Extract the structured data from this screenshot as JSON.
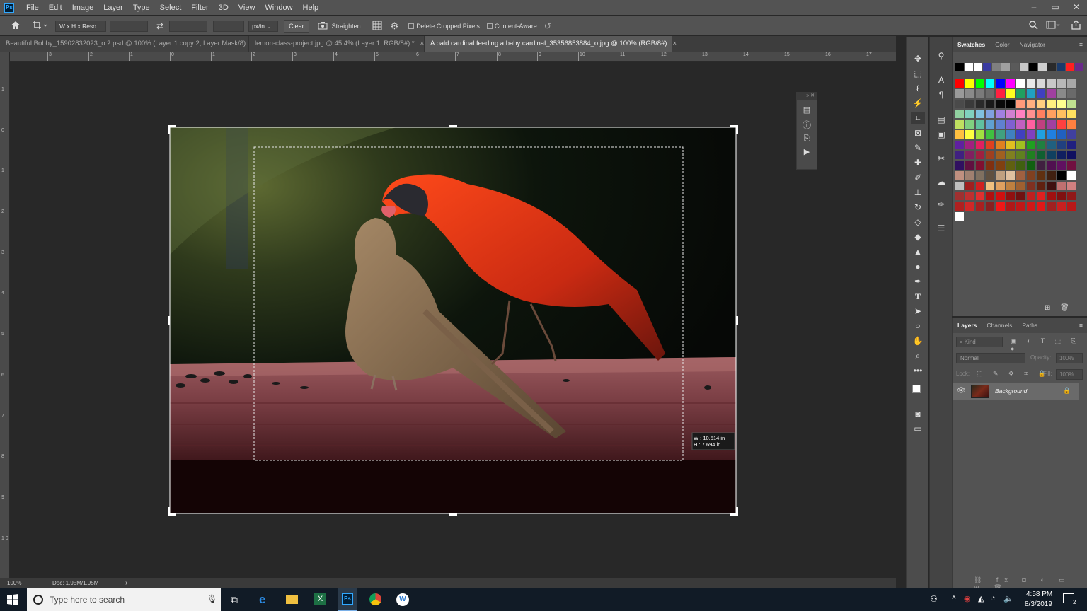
{
  "app": {
    "logo": "Ps"
  },
  "menu": [
    "File",
    "Edit",
    "Image",
    "Layer",
    "Type",
    "Select",
    "Filter",
    "3D",
    "View",
    "Window",
    "Help"
  ],
  "window_controls": [
    "–",
    "▭",
    "✕"
  ],
  "options": {
    "ratio_select": "W x H x Reso...",
    "units_select": "px/in",
    "clear": "Clear",
    "straighten": "Straighten",
    "delete_cropped": "Delete Cropped Pixels",
    "content_aware": "Content-Aware"
  },
  "tabs": [
    {
      "label": "Beautiful Bobby_15902832023_o 2.psd @ 100% (Layer 1 copy 2, Layer Mask/8)",
      "close": "×"
    },
    {
      "label": "lemon-class-project.jpg @ 45.4% (Layer 1, RGB/8#) *",
      "close": "×"
    },
    {
      "label": "A bald cardinal feeding a baby cardinal_35356853884_o.jpg @ 100% (RGB/8#)",
      "close": "×"
    }
  ],
  "ruler": {
    "h": [
      "3",
      "2",
      "1",
      "0",
      "1",
      "2",
      "3",
      "4",
      "5",
      "6",
      "7",
      "8",
      "9",
      "10",
      "11",
      "12",
      "13",
      "14",
      "15",
      "16",
      "17"
    ],
    "v": [
      "1",
      "0",
      "1",
      "2",
      "3",
      "4",
      "5",
      "6",
      "7",
      "8",
      "9",
      "1 0"
    ]
  },
  "crop_readout": {
    "w_label": "W :",
    "w": "10.514 in",
    "h_label": "H :",
    "h": "7.694 in"
  },
  "status": {
    "zoom": "100%",
    "doc": "Doc: 1.95M/1.95M",
    "arrow": "›"
  },
  "swatches": {
    "tabs": [
      "Swatches",
      "Color",
      "Navigator"
    ],
    "colors": [
      "#000000",
      "#ffffff",
      "#ffffff",
      "#3a3aa0",
      "#7f7f7f",
      "#a0a0a0",
      "#5a5a5a",
      "#c8c8c8",
      "#000000",
      "#d0d0d0",
      "#2a2a2a",
      "#1a3a6a",
      "#ff2020",
      "#6a2a8a",
      "#ff0000",
      "#ffff00",
      "#00ff00",
      "#00ffff",
      "#0000ff",
      "#ff00ff",
      "#ffffff",
      "#e8e8e8",
      "#d8d8d8",
      "#c8c8c8",
      "#b8b8b8",
      "#a8a8a8",
      "#9a9a9a",
      "#8a8a8a",
      "#7a7a7a",
      "#6a6a6a",
      "#ff2040",
      "#ffff20",
      "#20a060",
      "#20a0c0",
      "#4040c0",
      "#a040a0",
      "#8a8a8a",
      "#6a6a6a",
      "#4a4a4a",
      "#3a3a3a",
      "#2a2a2a",
      "#1a1a1a",
      "#0a0a0a",
      "#000000",
      "#ff9a7a",
      "#ffb080",
      "#ffd080",
      "#fff080",
      "#ffff90",
      "#c0e090",
      "#90d0a0",
      "#80d0c0",
      "#80c0e0",
      "#80a0e0",
      "#a080e0",
      "#d080d0",
      "#ff80c0",
      "#ff9090",
      "#ff8060",
      "#ffa060",
      "#ffc060",
      "#ffe060",
      "#c0e060",
      "#80d080",
      "#60c0a0",
      "#60a0d0",
      "#6080d0",
      "#8060d0",
      "#c060c0",
      "#ff60a0",
      "#c04080",
      "#a040a0",
      "#ff4040",
      "#ff8040",
      "#ffc040",
      "#ffff40",
      "#a0e040",
      "#40c040",
      "#40a080",
      "#4080c0",
      "#4040c0",
      "#8040c0",
      "#20a0e0",
      "#2080e0",
      "#2060c0",
      "#4040a0",
      "#6020a0",
      "#a02080",
      "#e02060",
      "#e04020",
      "#e08020",
      "#e0c020",
      "#a0c020",
      "#20a020",
      "#208040",
      "#206080",
      "#204080",
      "#202080",
      "#402080",
      "#802060",
      "#a02040",
      "#a04020",
      "#a06020",
      "#808020",
      "#608020",
      "#208020",
      "#106030",
      "#104060",
      "#102060",
      "#101060",
      "#301060",
      "#601040",
      "#801030",
      "#803010",
      "#804010",
      "#606010",
      "#406010",
      "#106010",
      "#402040",
      "#501050",
      "#601060",
      "#701040",
      "#c09080",
      "#a08070",
      "#807060",
      "#605040",
      "#c0a080",
      "#e0c0a0",
      "#a06040",
      "#804020",
      "#603010",
      "#402010",
      "#000000",
      "#ffffff",
      "#c0c0c0",
      "#a02020",
      "#d02020",
      "#f0c080",
      "#e0a060",
      "#c08040",
      "#a06030",
      "#803020",
      "#602010",
      "#401010",
      "#c07070",
      "#d08080",
      "#a03030",
      "#c03030",
      "#e03030",
      "#b01010",
      "#d01010",
      "#901010",
      "#701010",
      "#c02020",
      "#e02020",
      "#a01010",
      "#801010",
      "#901818",
      "#b02020",
      "#d02828",
      "#a82020",
      "#882020",
      "#f01818",
      "#b01818",
      "#c01818",
      "#d01818",
      "#e01818",
      "#a02020",
      "#c82020",
      "#b81818",
      "#ffffff"
    ]
  },
  "layers": {
    "tabs": [
      "Layers",
      "Channels",
      "Paths"
    ],
    "kind": "Kind",
    "blend": "Normal",
    "opacity_label": "Opacity:",
    "opacity": "100%",
    "lock_label": "Lock:",
    "fill_label": "Fill:",
    "fill": "100%",
    "layer_name": "Background"
  },
  "taskbar": {
    "search_placeholder": "Type here to search",
    "time": "4:58 PM",
    "date": "8/3/2019",
    "notif": "2"
  }
}
